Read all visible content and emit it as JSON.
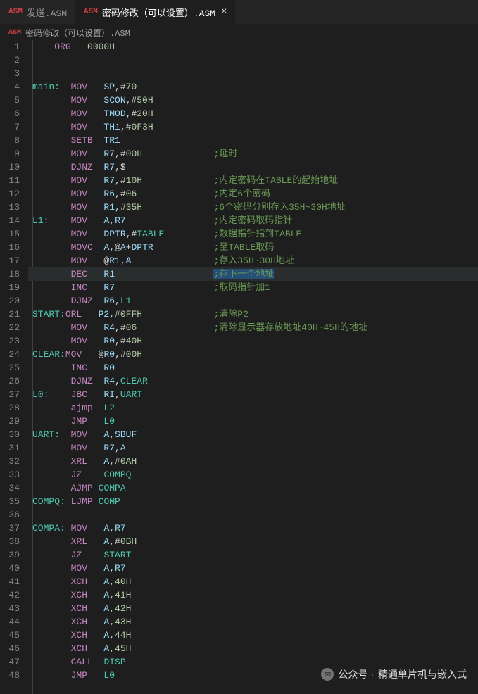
{
  "tabs": [
    {
      "icon": "ASM",
      "label": "发送.ASM",
      "active": false
    },
    {
      "icon": "ASM",
      "label": "密码修改（可以设置）.ASM",
      "active": true
    }
  ],
  "breadcrumb": {
    "icon": "ASM",
    "label": "密码修改（可以设置）.ASM"
  },
  "close_glyph": "×",
  "comment_col": 33,
  "code_lines": [
    {
      "n": 1,
      "hl": false,
      "tokens": [
        [
          "plain",
          "    "
        ],
        [
          "inst",
          "ORG"
        ],
        [
          "plain",
          "   "
        ],
        [
          "num",
          "0000H"
        ]
      ]
    },
    {
      "n": 2,
      "hl": false,
      "tokens": []
    },
    {
      "n": 3,
      "hl": false,
      "tokens": []
    },
    {
      "n": 4,
      "hl": false,
      "tokens": [
        [
          "label",
          "main:"
        ],
        [
          "plain",
          "  "
        ],
        [
          "inst",
          "MOV"
        ],
        [
          "plain",
          "   "
        ],
        [
          "reg",
          "SP"
        ],
        [
          "plain",
          ",#"
        ],
        [
          "num",
          "70"
        ]
      ]
    },
    {
      "n": 5,
      "hl": false,
      "tokens": [
        [
          "plain",
          "       "
        ],
        [
          "inst",
          "MOV"
        ],
        [
          "plain",
          "   "
        ],
        [
          "reg",
          "SCON"
        ],
        [
          "plain",
          ",#"
        ],
        [
          "num",
          "50H"
        ]
      ]
    },
    {
      "n": 6,
      "hl": false,
      "tokens": [
        [
          "plain",
          "       "
        ],
        [
          "inst",
          "MOV"
        ],
        [
          "plain",
          "   "
        ],
        [
          "reg",
          "TMOD"
        ],
        [
          "plain",
          ",#"
        ],
        [
          "num",
          "20H"
        ]
      ]
    },
    {
      "n": 7,
      "hl": false,
      "tokens": [
        [
          "plain",
          "       "
        ],
        [
          "inst",
          "MOV"
        ],
        [
          "plain",
          "   "
        ],
        [
          "reg",
          "TH1"
        ],
        [
          "plain",
          ",#"
        ],
        [
          "num",
          "0F3H"
        ]
      ]
    },
    {
      "n": 8,
      "hl": false,
      "tokens": [
        [
          "plain",
          "       "
        ],
        [
          "inst",
          "SETB"
        ],
        [
          "plain",
          "  "
        ],
        [
          "reg",
          "TR1"
        ]
      ]
    },
    {
      "n": 9,
      "hl": false,
      "tokens": [
        [
          "plain",
          "       "
        ],
        [
          "inst",
          "MOV"
        ],
        [
          "plain",
          "   "
        ],
        [
          "reg",
          "R7"
        ],
        [
          "plain",
          ",#"
        ],
        [
          "num",
          "00H"
        ]
      ],
      "comment": ";延时"
    },
    {
      "n": 10,
      "hl": false,
      "tokens": [
        [
          "plain",
          "       "
        ],
        [
          "inst",
          "DJNZ"
        ],
        [
          "plain",
          "  "
        ],
        [
          "reg",
          "R7"
        ],
        [
          "plain",
          ",$"
        ]
      ]
    },
    {
      "n": 11,
      "hl": false,
      "tokens": [
        [
          "plain",
          "       "
        ],
        [
          "inst",
          "MOV"
        ],
        [
          "plain",
          "   "
        ],
        [
          "reg",
          "R7"
        ],
        [
          "plain",
          ",#"
        ],
        [
          "num",
          "10H"
        ]
      ],
      "comment": ";内定密码在TABLE的起始地址"
    },
    {
      "n": 12,
      "hl": false,
      "tokens": [
        [
          "plain",
          "       "
        ],
        [
          "inst",
          "MOV"
        ],
        [
          "plain",
          "   "
        ],
        [
          "reg",
          "R6"
        ],
        [
          "plain",
          ",#"
        ],
        [
          "num",
          "06"
        ]
      ],
      "comment": ";内定6个密码"
    },
    {
      "n": 13,
      "hl": false,
      "tokens": [
        [
          "plain",
          "       "
        ],
        [
          "inst",
          "MOV"
        ],
        [
          "plain",
          "   "
        ],
        [
          "reg",
          "R1"
        ],
        [
          "plain",
          ",#"
        ],
        [
          "num",
          "35H"
        ]
      ],
      "comment": ";6个密码分别存入35H~30H地址"
    },
    {
      "n": 14,
      "hl": false,
      "tokens": [
        [
          "label",
          "L1:"
        ],
        [
          "plain",
          "    "
        ],
        [
          "inst",
          "MOV"
        ],
        [
          "plain",
          "   "
        ],
        [
          "reg",
          "A"
        ],
        [
          "plain",
          ","
        ],
        [
          "reg",
          "R7"
        ]
      ],
      "comment": ";内定密码取码指针"
    },
    {
      "n": 15,
      "hl": false,
      "tokens": [
        [
          "plain",
          "       "
        ],
        [
          "inst",
          "MOV"
        ],
        [
          "plain",
          "   "
        ],
        [
          "reg",
          "DPTR"
        ],
        [
          "plain",
          ",#"
        ],
        [
          "label",
          "TABLE"
        ]
      ],
      "comment": ";数据指针指到TABLE"
    },
    {
      "n": 16,
      "hl": false,
      "tokens": [
        [
          "plain",
          "       "
        ],
        [
          "inst",
          "MOVC"
        ],
        [
          "plain",
          "  "
        ],
        [
          "reg",
          "A"
        ],
        [
          "plain",
          ",@"
        ],
        [
          "reg",
          "A"
        ],
        [
          "plain",
          "+"
        ],
        [
          "reg",
          "DPTR"
        ]
      ],
      "comment": ";至TABLE取码"
    },
    {
      "n": 17,
      "hl": false,
      "tokens": [
        [
          "plain",
          "       "
        ],
        [
          "inst",
          "MOV"
        ],
        [
          "plain",
          "   @"
        ],
        [
          "reg",
          "R1"
        ],
        [
          "plain",
          ","
        ],
        [
          "reg",
          "A"
        ]
      ],
      "comment": ";存入35H~30H地址"
    },
    {
      "n": 18,
      "hl": true,
      "tokens": [
        [
          "plain",
          "       "
        ],
        [
          "inst",
          "DEC"
        ],
        [
          "plain",
          "   "
        ],
        [
          "reg",
          "R1"
        ]
      ],
      "comment": ";存下一个地址",
      "comment_hl": true
    },
    {
      "n": 19,
      "hl": false,
      "tokens": [
        [
          "plain",
          "       "
        ],
        [
          "inst",
          "INC"
        ],
        [
          "plain",
          "   "
        ],
        [
          "reg",
          "R7"
        ]
      ],
      "comment": ";取码指针加1"
    },
    {
      "n": 20,
      "hl": false,
      "tokens": [
        [
          "plain",
          "       "
        ],
        [
          "inst",
          "DJNZ"
        ],
        [
          "plain",
          "  "
        ],
        [
          "reg",
          "R6"
        ],
        [
          "plain",
          ","
        ],
        [
          "label",
          "L1"
        ]
      ]
    },
    {
      "n": 21,
      "hl": false,
      "tokens": [
        [
          "label",
          "START:"
        ],
        [
          "inst",
          "ORL"
        ],
        [
          "plain",
          "   "
        ],
        [
          "reg",
          "P2"
        ],
        [
          "plain",
          ",#"
        ],
        [
          "num",
          "0FFH"
        ]
      ],
      "comment": ";清除P2"
    },
    {
      "n": 22,
      "hl": false,
      "tokens": [
        [
          "plain",
          "       "
        ],
        [
          "inst",
          "MOV"
        ],
        [
          "plain",
          "   "
        ],
        [
          "reg",
          "R4"
        ],
        [
          "plain",
          ",#"
        ],
        [
          "num",
          "06"
        ]
      ],
      "comment": ";清除显示器存放地址40H~45H的地址"
    },
    {
      "n": 23,
      "hl": false,
      "tokens": [
        [
          "plain",
          "       "
        ],
        [
          "inst",
          "MOV"
        ],
        [
          "plain",
          "   "
        ],
        [
          "reg",
          "R0"
        ],
        [
          "plain",
          ",#"
        ],
        [
          "num",
          "40H"
        ]
      ]
    },
    {
      "n": 24,
      "hl": false,
      "tokens": [
        [
          "label",
          "CLEAR:"
        ],
        [
          "inst",
          "MOV"
        ],
        [
          "plain",
          "   @"
        ],
        [
          "reg",
          "R0"
        ],
        [
          "plain",
          ",#"
        ],
        [
          "num",
          "00H"
        ]
      ]
    },
    {
      "n": 25,
      "hl": false,
      "tokens": [
        [
          "plain",
          "       "
        ],
        [
          "inst",
          "INC"
        ],
        [
          "plain",
          "   "
        ],
        [
          "reg",
          "R0"
        ]
      ]
    },
    {
      "n": 26,
      "hl": false,
      "tokens": [
        [
          "plain",
          "       "
        ],
        [
          "inst",
          "DJNZ"
        ],
        [
          "plain",
          "  "
        ],
        [
          "reg",
          "R4"
        ],
        [
          "plain",
          ","
        ],
        [
          "label",
          "CLEAR"
        ]
      ]
    },
    {
      "n": 27,
      "hl": false,
      "tokens": [
        [
          "label",
          "L0:"
        ],
        [
          "plain",
          "    "
        ],
        [
          "inst",
          "JBC"
        ],
        [
          "plain",
          "   "
        ],
        [
          "reg",
          "RI"
        ],
        [
          "plain",
          ","
        ],
        [
          "label",
          "UART"
        ]
      ]
    },
    {
      "n": 28,
      "hl": false,
      "tokens": [
        [
          "plain",
          "       "
        ],
        [
          "inst",
          "ajmp"
        ],
        [
          "plain",
          "  "
        ],
        [
          "label",
          "L2"
        ]
      ]
    },
    {
      "n": 29,
      "hl": false,
      "tokens": [
        [
          "plain",
          "       "
        ],
        [
          "inst",
          "JMP"
        ],
        [
          "plain",
          "   "
        ],
        [
          "label",
          "L0"
        ]
      ]
    },
    {
      "n": 30,
      "hl": false,
      "tokens": [
        [
          "label",
          "UART:"
        ],
        [
          "plain",
          "  "
        ],
        [
          "inst",
          "MOV"
        ],
        [
          "plain",
          "   "
        ],
        [
          "reg",
          "A"
        ],
        [
          "plain",
          ","
        ],
        [
          "reg",
          "SBUF"
        ]
      ]
    },
    {
      "n": 31,
      "hl": false,
      "tokens": [
        [
          "plain",
          "       "
        ],
        [
          "inst",
          "MOV"
        ],
        [
          "plain",
          "   "
        ],
        [
          "reg",
          "R7"
        ],
        [
          "plain",
          ","
        ],
        [
          "reg",
          "A"
        ]
      ]
    },
    {
      "n": 32,
      "hl": false,
      "tokens": [
        [
          "plain",
          "       "
        ],
        [
          "inst",
          "XRL"
        ],
        [
          "plain",
          "   "
        ],
        [
          "reg",
          "A"
        ],
        [
          "plain",
          ",#"
        ],
        [
          "num",
          "0AH"
        ]
      ]
    },
    {
      "n": 33,
      "hl": false,
      "tokens": [
        [
          "plain",
          "       "
        ],
        [
          "inst",
          "JZ"
        ],
        [
          "plain",
          "    "
        ],
        [
          "label",
          "COMPQ"
        ]
      ]
    },
    {
      "n": 34,
      "hl": false,
      "tokens": [
        [
          "plain",
          "       "
        ],
        [
          "inst",
          "AJMP"
        ],
        [
          "plain",
          " "
        ],
        [
          "label",
          "COMPA"
        ]
      ]
    },
    {
      "n": 35,
      "hl": false,
      "tokens": [
        [
          "label",
          "COMPQ:"
        ],
        [
          "plain",
          " "
        ],
        [
          "inst",
          "LJMP"
        ],
        [
          "plain",
          " "
        ],
        [
          "label",
          "COMP"
        ]
      ]
    },
    {
      "n": 36,
      "hl": false,
      "tokens": []
    },
    {
      "n": 37,
      "hl": false,
      "tokens": [
        [
          "label",
          "COMPA:"
        ],
        [
          "plain",
          " "
        ],
        [
          "inst",
          "MOV"
        ],
        [
          "plain",
          "   "
        ],
        [
          "reg",
          "A"
        ],
        [
          "plain",
          ","
        ],
        [
          "reg",
          "R7"
        ]
      ]
    },
    {
      "n": 38,
      "hl": false,
      "tokens": [
        [
          "plain",
          "       "
        ],
        [
          "inst",
          "XRL"
        ],
        [
          "plain",
          "   "
        ],
        [
          "reg",
          "A"
        ],
        [
          "plain",
          ",#"
        ],
        [
          "num",
          "0BH"
        ]
      ]
    },
    {
      "n": 39,
      "hl": false,
      "tokens": [
        [
          "plain",
          "       "
        ],
        [
          "inst",
          "JZ"
        ],
        [
          "plain",
          "    "
        ],
        [
          "label",
          "START"
        ]
      ]
    },
    {
      "n": 40,
      "hl": false,
      "tokens": [
        [
          "plain",
          "       "
        ],
        [
          "inst",
          "MOV"
        ],
        [
          "plain",
          "   "
        ],
        [
          "reg",
          "A"
        ],
        [
          "plain",
          ","
        ],
        [
          "reg",
          "R7"
        ]
      ]
    },
    {
      "n": 41,
      "hl": false,
      "tokens": [
        [
          "plain",
          "       "
        ],
        [
          "inst",
          "XCH"
        ],
        [
          "plain",
          "   "
        ],
        [
          "reg",
          "A"
        ],
        [
          "plain",
          ","
        ],
        [
          "num",
          "40H"
        ]
      ]
    },
    {
      "n": 42,
      "hl": false,
      "tokens": [
        [
          "plain",
          "       "
        ],
        [
          "inst",
          "XCH"
        ],
        [
          "plain",
          "   "
        ],
        [
          "reg",
          "A"
        ],
        [
          "plain",
          ","
        ],
        [
          "num",
          "41H"
        ]
      ]
    },
    {
      "n": 43,
      "hl": false,
      "tokens": [
        [
          "plain",
          "       "
        ],
        [
          "inst",
          "XCH"
        ],
        [
          "plain",
          "   "
        ],
        [
          "reg",
          "A"
        ],
        [
          "plain",
          ","
        ],
        [
          "num",
          "42H"
        ]
      ]
    },
    {
      "n": 44,
      "hl": false,
      "tokens": [
        [
          "plain",
          "       "
        ],
        [
          "inst",
          "XCH"
        ],
        [
          "plain",
          "   "
        ],
        [
          "reg",
          "A"
        ],
        [
          "plain",
          ","
        ],
        [
          "num",
          "43H"
        ]
      ]
    },
    {
      "n": 45,
      "hl": false,
      "tokens": [
        [
          "plain",
          "       "
        ],
        [
          "inst",
          "XCH"
        ],
        [
          "plain",
          "   "
        ],
        [
          "reg",
          "A"
        ],
        [
          "plain",
          ","
        ],
        [
          "num",
          "44H"
        ]
      ]
    },
    {
      "n": 46,
      "hl": false,
      "tokens": [
        [
          "plain",
          "       "
        ],
        [
          "inst",
          "XCH"
        ],
        [
          "plain",
          "   "
        ],
        [
          "reg",
          "A"
        ],
        [
          "plain",
          ","
        ],
        [
          "num",
          "45H"
        ]
      ]
    },
    {
      "n": 47,
      "hl": false,
      "tokens": [
        [
          "plain",
          "       "
        ],
        [
          "inst",
          "CALL"
        ],
        [
          "plain",
          "  "
        ],
        [
          "label",
          "DISP"
        ]
      ]
    },
    {
      "n": 48,
      "hl": false,
      "tokens": [
        [
          "plain",
          "       "
        ],
        [
          "inst",
          "JMP"
        ],
        [
          "plain",
          "   "
        ],
        [
          "label",
          "L0"
        ]
      ]
    }
  ],
  "watermark": {
    "prefix": "公众号 · ",
    "name": "精通单片机与嵌入式"
  }
}
